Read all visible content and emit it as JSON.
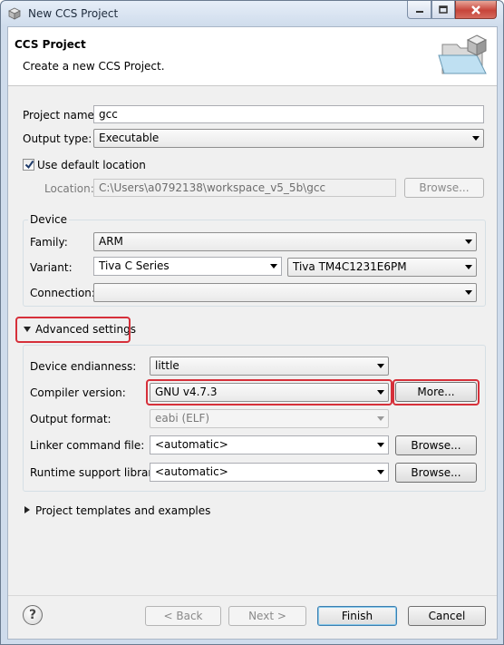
{
  "window": {
    "title": "New CCS Project"
  },
  "header": {
    "title": "CCS Project",
    "description": "Create a new CCS Project."
  },
  "project": {
    "name_label": "Project name:",
    "name_value": "gcc",
    "output_type_label": "Output type:",
    "output_type_value": "Executable",
    "use_default_location_label": "Use default location",
    "location_label": "Location:",
    "location_value": "C:\\Users\\a0792138\\workspace_v5_5b\\gcc",
    "browse_label": "Browse..."
  },
  "device": {
    "group_label": "Device",
    "family_label": "Family:",
    "family_value": "ARM",
    "variant_label": "Variant:",
    "variant_series_value": "Tiva C Series",
    "variant_device_value": "Tiva TM4C1231E6PM",
    "connection_label": "Connection:",
    "connection_value": ""
  },
  "advanced": {
    "toggle_label": "Advanced settings",
    "endianness_label": "Device endianness:",
    "endianness_value": "little",
    "compiler_label": "Compiler version:",
    "compiler_value": "GNU v4.7.3",
    "more_label": "More...",
    "output_format_label": "Output format:",
    "output_format_value": "eabi (ELF)",
    "linker_label": "Linker command file:",
    "linker_value": "<automatic>",
    "linker_browse_label": "Browse...",
    "runtime_label": "Runtime support library:",
    "runtime_value": "<automatic>",
    "runtime_browse_label": "Browse..."
  },
  "templates": {
    "toggle_label": "Project templates and examples"
  },
  "footer": {
    "help": "?",
    "back_label": "< Back",
    "next_label": "Next >",
    "finish_label": "Finish",
    "cancel_label": "Cancel"
  },
  "colors": {
    "highlight": "#d6303a",
    "title_bar": "#cfdcec"
  }
}
